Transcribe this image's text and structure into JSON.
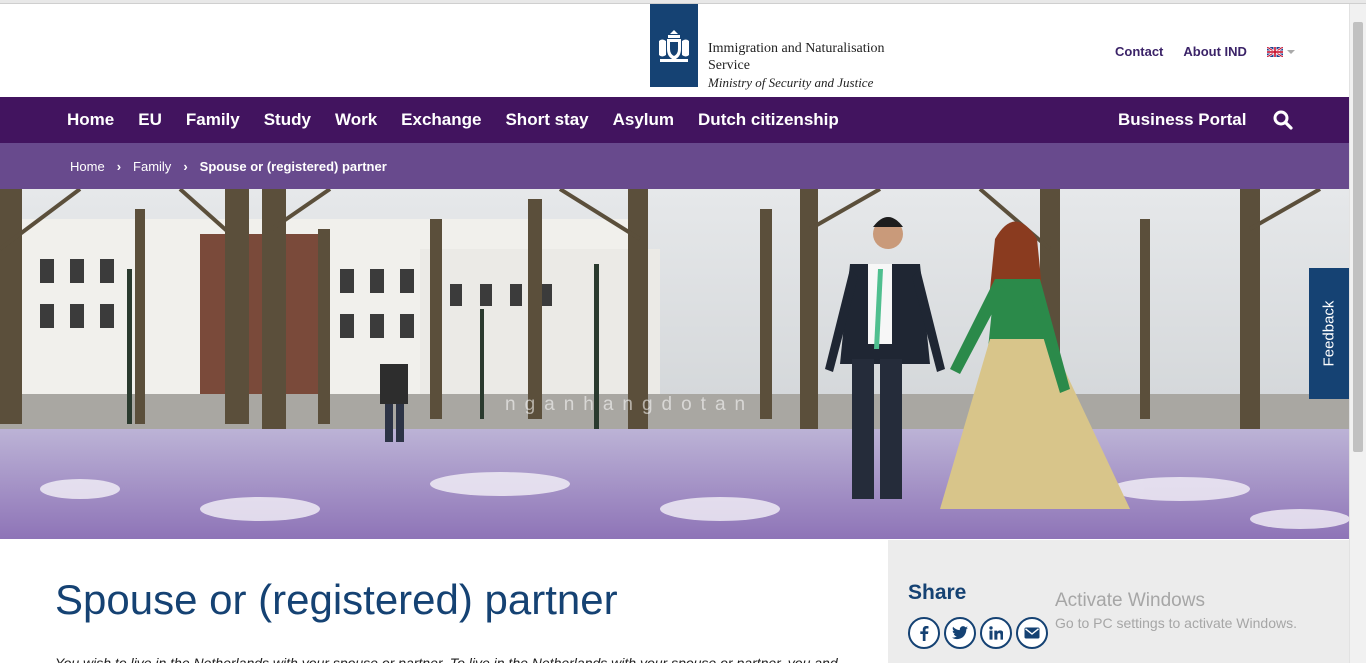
{
  "header": {
    "org_line1": "Immigration and Naturalisation",
    "org_line2": "Service",
    "org_line3": "Ministry of Security and Justice",
    "links": {
      "contact": "Contact",
      "about": "About IND"
    },
    "language": "English"
  },
  "nav": {
    "items": [
      {
        "label": "Home"
      },
      {
        "label": "EU"
      },
      {
        "label": "Family"
      },
      {
        "label": "Study"
      },
      {
        "label": "Work"
      },
      {
        "label": "Exchange"
      },
      {
        "label": "Short stay"
      },
      {
        "label": "Asylum"
      },
      {
        "label": "Dutch citizenship"
      }
    ],
    "business_portal": "Business Portal"
  },
  "breadcrumb": {
    "items": [
      {
        "label": "Home"
      },
      {
        "label": "Family"
      }
    ],
    "current": "Spouse or (registered) partner",
    "separator": "›"
  },
  "hero": {
    "watermark": "nganhangdotan"
  },
  "feedback": {
    "label": "Feedback"
  },
  "main": {
    "title": "Spouse or (registered) partner",
    "intro": "You wish to live in the Netherlands with your spouse or partner. To live in the Netherlands with your spouse or partner, you and"
  },
  "share": {
    "title": "Share",
    "icons": [
      "facebook-icon",
      "twitter-icon",
      "linkedin-icon",
      "email-icon"
    ]
  },
  "os_overlay": {
    "line1": "Activate Windows",
    "line2": "Go to PC settings to activate Windows."
  },
  "colors": {
    "nav": "#42145f",
    "breadcrumb": "#684a8d",
    "brand_blue": "#154273"
  }
}
